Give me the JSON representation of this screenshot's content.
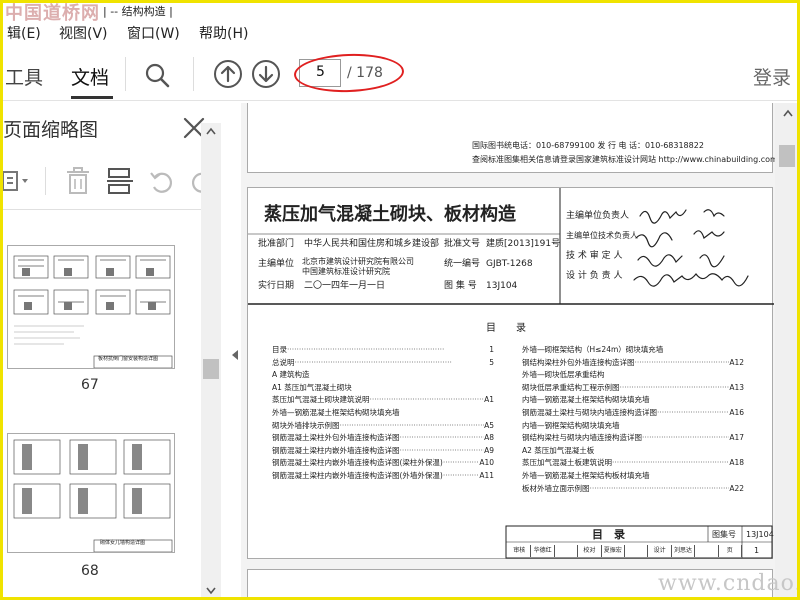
{
  "watermark_top": "中国道桥网",
  "title_fragment": "| -- 结构构造 |",
  "menu": [
    "辑(E)",
    "视图(V)",
    "窗口(W)",
    "帮助(H)"
  ],
  "toolbar": {
    "tab_tools": "工具",
    "tab_document": "文档",
    "page_current": "5",
    "page_total": "/ 178",
    "login": "登录"
  },
  "thumbs": {
    "title": "页面缩略图",
    "page_numbers": [
      "67",
      "68"
    ],
    "thumb67_caption": "板材抗倒门窗安装构造详图",
    "thumb68_caption": "砌体女儿墙构造详图"
  },
  "prev_page": {
    "line1": "国际图书统电话：010-68799100      发 行 电 话：010-68318822",
    "line2": "查阅标准图集相关信息请登录国家建筑标准设计网站 http://www.chinabuilding.com.cn"
  },
  "header": {
    "title": "蒸压加气混凝土砌块、板材构造",
    "approval_dept_label": "批准部门",
    "approval_dept": "中华人民共和国住房和城乡建设部",
    "approval_doc_label": "批准文号",
    "approval_doc": "建质[2013]191号",
    "editor_label": "主编单位",
    "editor_1": "北京市建筑设计研究院有限公司",
    "editor_2": "中国建筑标准设计研究院",
    "unified_label": "统一编号",
    "unified_no": "GJBT-1268",
    "effective_label": "实行日期",
    "effective_date": "二〇一四年一月一日",
    "atlas_label": "图 集 号",
    "atlas_no": "13J104",
    "roles": [
      "主编单位负责人",
      "主编单位技术负责人",
      "技 术 审 定 人",
      "设 计 负 责 人"
    ]
  },
  "toc": {
    "heading": "目　　录",
    "left": [
      {
        "text": "目录",
        "page": "1"
      },
      {
        "text": "总说明",
        "page": "5"
      },
      {
        "text": "A 建筑构造",
        "page": ""
      },
      {
        "text": "A1 蒸压加气混凝土砌块",
        "page": ""
      },
      {
        "text": "蒸压加气混凝土砌块建筑说明",
        "page": "A1"
      },
      {
        "text": "外墙—钢筋混凝土框架结构砌块填充墙",
        "page": ""
      },
      {
        "text": "砌块外墙排块示例图",
        "page": "A5"
      },
      {
        "text": "钢筋混凝土梁柱外包外墙连接构造详图",
        "page": "A8"
      },
      {
        "text": "钢筋混凝土梁柱内嵌外墙连接构造详图",
        "page": "A9"
      },
      {
        "text": "钢筋混凝土梁柱内嵌外墙连接构造详图(梁柱外保温)",
        "page": "A10"
      },
      {
        "text": "钢筋混凝土梁柱内嵌外墙连接构造详图(外墙外保温)",
        "page": "A11"
      }
    ],
    "right": [
      {
        "text": "外墙—砌框架结构（H≤24m）砌块填充墙",
        "page": ""
      },
      {
        "text": "钢结构梁柱外包外墙连接构造详图",
        "page": "A12"
      },
      {
        "text": "外墙—砌块低层承重结构",
        "page": ""
      },
      {
        "text": "砌块低层承重结构工程示例图",
        "page": "A13"
      },
      {
        "text": "内墙—钢筋混凝土框架结构砌块填充墙",
        "page": ""
      },
      {
        "text": "钢筋混凝土梁柱与砌块内墙连接构造详图",
        "page": "A16"
      },
      {
        "text": "内墙—钢框架结构砌块填充墙",
        "page": ""
      },
      {
        "text": "钢结构梁柱与砌块内墙连接构造详图",
        "page": "A17"
      },
      {
        "text": "A2 蒸压加气混凝土板",
        "page": ""
      },
      {
        "text": "蒸压加气混凝土板建筑说明",
        "page": "A18"
      },
      {
        "text": "外墙—钢筋混凝土框架结构板材填充墙",
        "page": ""
      },
      {
        "text": "板材外墙立面示例图",
        "page": "A22"
      }
    ]
  },
  "footer": {
    "title": "目　录",
    "atlas_label": "图集号",
    "atlas_no": "13J104",
    "sig_cells": [
      "审核",
      "华德红",
      "",
      "校对",
      "夏振宏",
      "",
      "设计",
      "刘思达",
      "",
      "页"
    ],
    "page_no": "1"
  },
  "watermark_bottom": "www.cndao.com"
}
